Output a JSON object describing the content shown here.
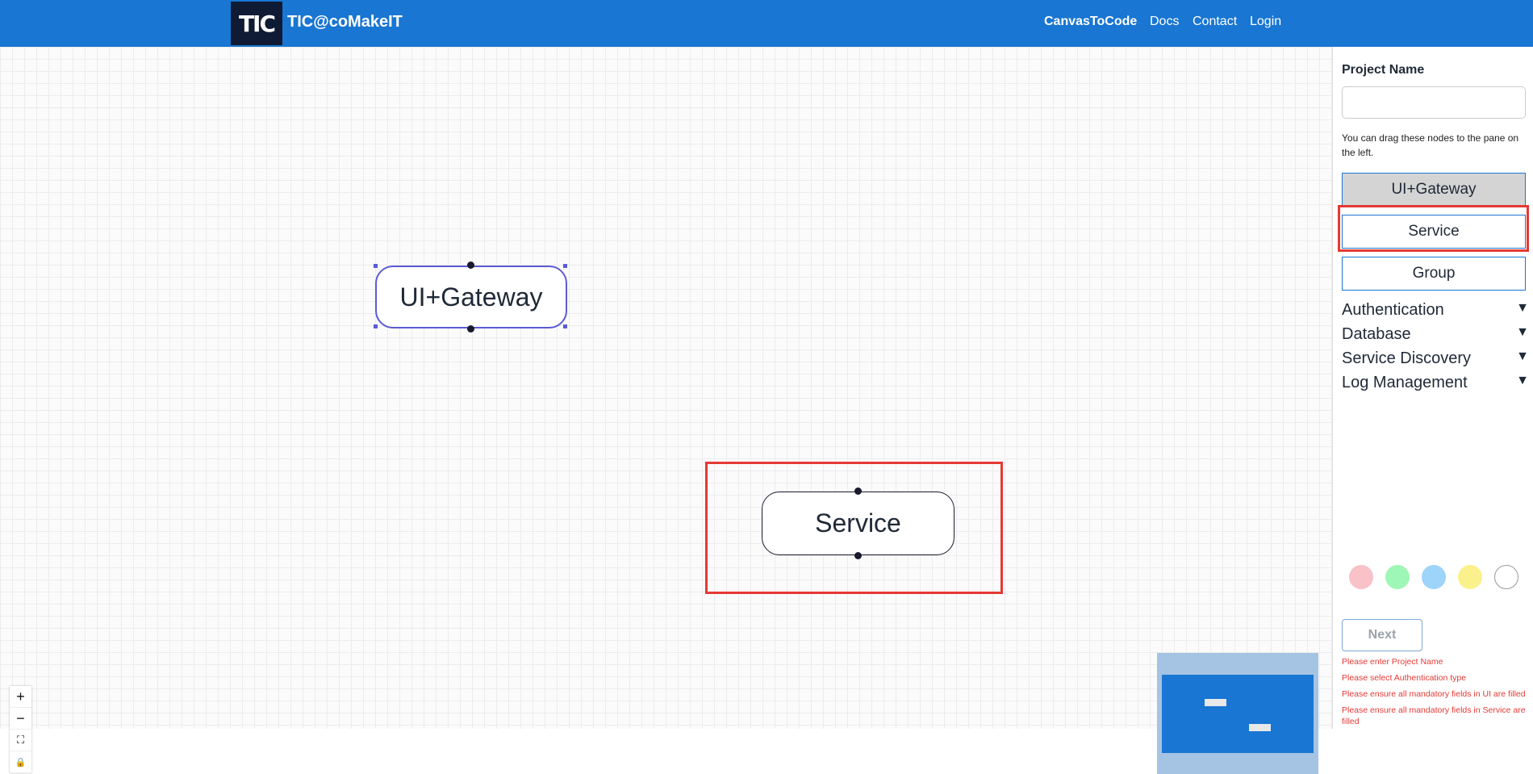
{
  "header": {
    "logo_text": "TIC",
    "brand": "TIC@coMakeIT",
    "nav": [
      "CanvasToCode",
      "Docs",
      "Contact",
      "Login"
    ]
  },
  "canvas": {
    "nodes": [
      {
        "label": "UI+Gateway",
        "selected": true
      },
      {
        "label": "Service",
        "selected": false
      }
    ],
    "controls": [
      "+",
      "−",
      "⛶",
      "🔒"
    ]
  },
  "sidebar": {
    "project_name_label": "Project Name",
    "project_name_value": "",
    "hint": "You can drag these nodes to the pane on the left.",
    "node_types": [
      "UI+Gateway",
      "Service",
      "Group"
    ],
    "accordions": [
      "Authentication",
      "Database",
      "Service Discovery",
      "Log Management"
    ],
    "accordion_arrow": "▼",
    "colors": [
      "#f9c1c8",
      "#9ef7b7",
      "#9ed3fa",
      "#fbf18c",
      "#ffffff"
    ],
    "next_label": "Next",
    "errors": [
      "Please enter Project Name",
      "Please select Authentication type",
      "Please ensure all mandatory fields in UI are filled",
      "Please ensure all mandatory fields in Service are filled"
    ]
  }
}
